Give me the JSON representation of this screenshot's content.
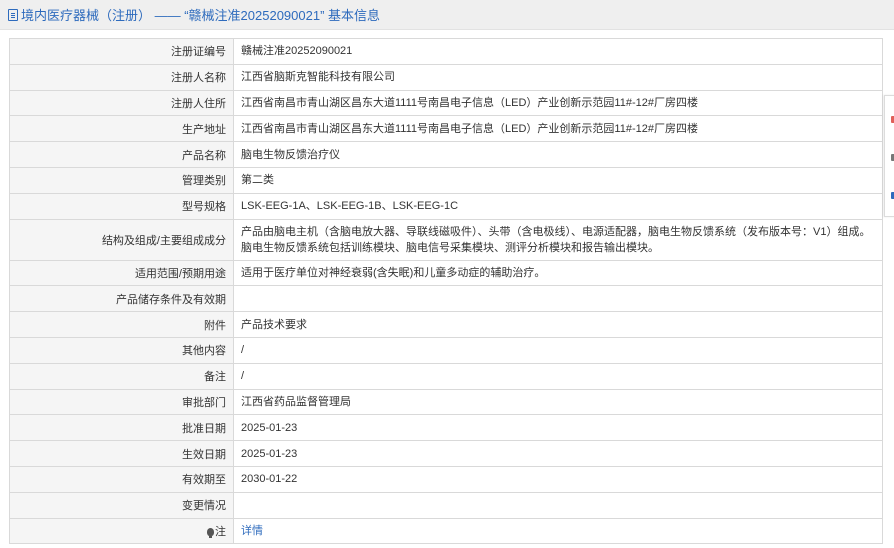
{
  "header": {
    "title": "境内医疗器械（注册） —— “赣械注准20252090021” 基本信息",
    "icon": "document-icon"
  },
  "rows": [
    {
      "label": "注册证编号",
      "value": "赣械注准20252090021"
    },
    {
      "label": "注册人名称",
      "value": "江西省脑斯克智能科技有限公司"
    },
    {
      "label": "注册人住所",
      "value": "江西省南昌市青山湖区昌东大道1111号南昌电子信息（LED）产业创新示范园11#-12#厂房四楼"
    },
    {
      "label": "生产地址",
      "value": "江西省南昌市青山湖区昌东大道1111号南昌电子信息（LED）产业创新示范园11#-12#厂房四楼"
    },
    {
      "label": "产品名称",
      "value": "脑电生物反馈治疗仪"
    },
    {
      "label": "管理类别",
      "value": "第二类"
    },
    {
      "label": "型号规格",
      "value": "LSK-EEG-1A、LSK-EEG-1B、LSK-EEG-1C"
    },
    {
      "label": "结构及组成/主要组成成分",
      "value": "产品由脑电主机（含脑电放大器、导联线磁吸件）、头带（含电极线）、电源适配器，脑电生物反馈系统（发布版本号：V1）组成。脑电生物反馈系统包括训练模块、脑电信号采集模块、测评分析模块和报告输出模块。"
    },
    {
      "label": "适用范围/预期用途",
      "value": "适用于医疗单位对神经衰弱(含失眠)和儿童多动症的辅助治疗。"
    },
    {
      "label": "产品储存条件及有效期",
      "value": ""
    },
    {
      "label": "附件",
      "value": "产品技术要求"
    },
    {
      "label": "其他内容",
      "value": "/"
    },
    {
      "label": "备注",
      "value": "/"
    },
    {
      "label": "审批部门",
      "value": "江西省药品监督管理局"
    },
    {
      "label": "批准日期",
      "value": "2025-01-23"
    },
    {
      "label": "生效日期",
      "value": "2025-01-23"
    },
    {
      "label": "有效期至",
      "value": "2030-01-22"
    },
    {
      "label": "变更情况",
      "value": ""
    },
    {
      "label": "注",
      "value": "详情",
      "icon": "lightbulb-icon"
    }
  ],
  "colors": {
    "link": "#2e6bbd",
    "header_bg": "#efefef",
    "label_bg": "#f5f5f5",
    "border": "#d9d9d9"
  }
}
